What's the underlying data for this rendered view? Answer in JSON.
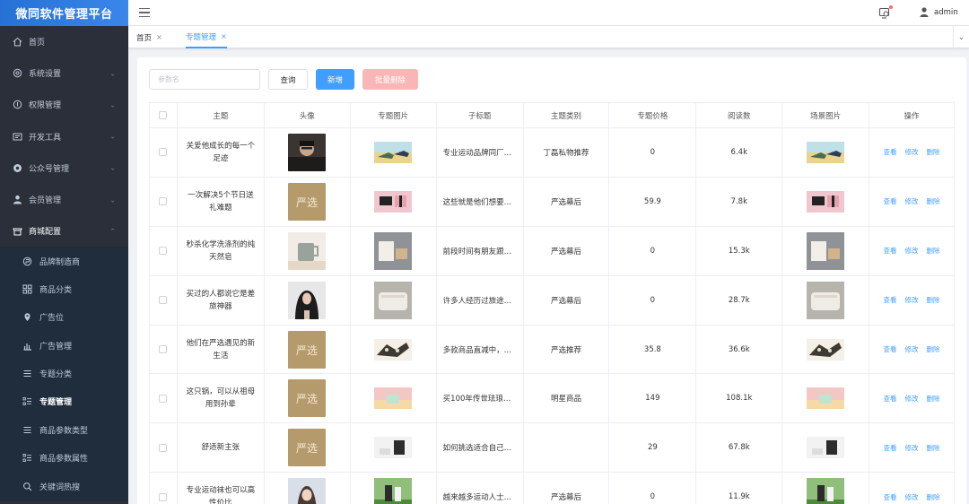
{
  "app": {
    "title": "微同软件管理平台"
  },
  "sidebar": {
    "items": [
      {
        "label": "首页",
        "icon": "home-icon",
        "arrow": false
      },
      {
        "label": "系统设置",
        "icon": "settings-icon",
        "arrow": true
      },
      {
        "label": "权限管理",
        "icon": "permission-icon",
        "arrow": true
      },
      {
        "label": "开发工具",
        "icon": "devtools-icon",
        "arrow": true
      },
      {
        "label": "公众号管理",
        "icon": "official-account-icon",
        "arrow": true
      },
      {
        "label": "会员管理",
        "icon": "member-icon",
        "arrow": true
      }
    ],
    "open_group": {
      "label": "商城配置",
      "icon": "shop-icon"
    },
    "sub_items": [
      {
        "label": "品牌制造商",
        "icon": "brand-icon",
        "active": false
      },
      {
        "label": "商品分类",
        "icon": "category-grid-icon",
        "active": false
      },
      {
        "label": "广告位",
        "icon": "location-pin-icon",
        "active": false
      },
      {
        "label": "广告管理",
        "icon": "bar-chart-icon",
        "active": false
      },
      {
        "label": "专题分类",
        "icon": "list-icon",
        "active": false
      },
      {
        "label": "专题管理",
        "icon": "list-detail-icon",
        "active": true
      },
      {
        "label": "商品参数类型",
        "icon": "list-icon",
        "active": false
      },
      {
        "label": "商品参数属性",
        "icon": "list-detail-icon",
        "active": false
      },
      {
        "label": "关键词热搜",
        "icon": "search-icon",
        "active": false
      }
    ]
  },
  "header": {
    "user": "admin"
  },
  "tabs": [
    {
      "label": "首页",
      "close": "×",
      "active": false
    },
    {
      "label": "专题管理",
      "close": "×",
      "active": true
    }
  ],
  "toolbar": {
    "search_placeholder": "参数名",
    "query_label": "查询",
    "add_label": "新增",
    "batch_delete_label": "批量删除"
  },
  "table": {
    "columns": [
      "主题",
      "头像",
      "专题图片",
      "子标题",
      "主题类别",
      "专题价格",
      "阅读数",
      "场景图片",
      "操作"
    ],
    "actions": [
      "查看",
      "修改",
      "删除"
    ],
    "rows": [
      {
        "title": "关爱他成长的每一个足迹",
        "avatar": "man-photo",
        "image": "shoes",
        "subtitle": "专业运动品牌同厂…",
        "category": "丁磊私物推荐",
        "price": "0",
        "reads": "6.4k"
      },
      {
        "title": "一次解决5个节日送礼难题",
        "avatar": "yanxuan-logo",
        "image": "gift",
        "subtitle": "这些就是他们想要…",
        "category": "严选幕后",
        "price": "59.9",
        "reads": "7.8k"
      },
      {
        "title": "秒杀化学洗涤剂的纯天然皂",
        "avatar": "mug-photo",
        "image": "soap",
        "subtitle": "前段时间有朋友跟…",
        "category": "严选幕后",
        "price": "0",
        "reads": "15.3k"
      },
      {
        "title": "买过的人都说它是差旅神器",
        "avatar": "woman-photo",
        "image": "towels",
        "subtitle": "许多人经历过旅途…",
        "category": "严选幕后",
        "price": "0",
        "reads": "28.7k"
      },
      {
        "title": "他们在严选遇见的新生活",
        "avatar": "yanxuan-logo",
        "image": "scarf",
        "subtitle": "多款商品直减中，…",
        "category": "严选推荐",
        "price": "35.8",
        "reads": "36.6k"
      },
      {
        "title": "这只锅，可以从祖母用到孙辈",
        "avatar": "yanxuan-logo",
        "image": "pot",
        "subtitle": "买100年传世珐琅…",
        "category": "明星商品",
        "price": "149",
        "reads": "108.1k"
      },
      {
        "title": "舒适新主张",
        "avatar": "yanxuan-logo",
        "image": "room",
        "subtitle": "如何挑选适合自己…",
        "category": "",
        "price": "29",
        "reads": "67.8k"
      },
      {
        "title": "专业运动袜也可以高性价比",
        "avatar": "girl-photo",
        "image": "sport",
        "subtitle": "越来越多运动人士…",
        "category": "严选幕后",
        "price": "0",
        "reads": "11.9k"
      }
    ]
  }
}
